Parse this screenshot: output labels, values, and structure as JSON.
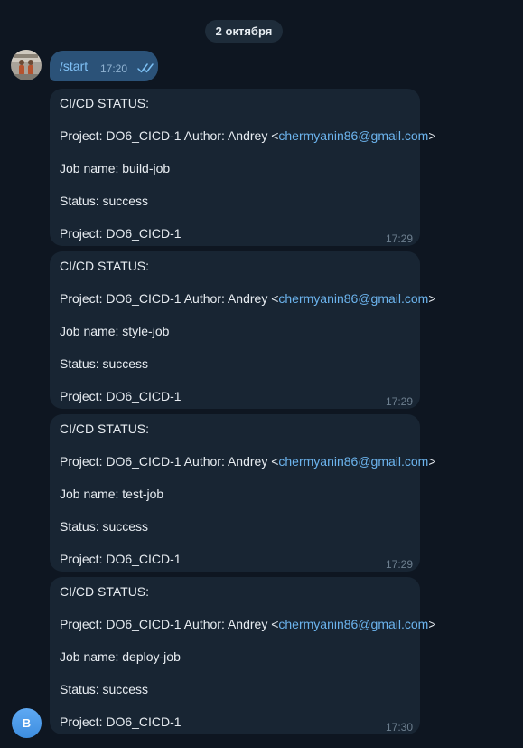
{
  "chat": {
    "date_label": "2 октября",
    "outgoing": {
      "text": "/start",
      "time": "17:20",
      "status_icon": "double-check-read-icon"
    },
    "bot_avatar_letter": "B",
    "messages": [
      {
        "title": "CI/CD STATUS:",
        "project_line_prefix": "Project: DO6_CICD-1 Author: Andrey <",
        "email": "chermyanin86@gmail.com",
        "project_line_suffix": ">",
        "job_line": "Job name: build-job",
        "status_line": "Status: success",
        "project_line": "Project: DO6_CICD-1",
        "time": "17:29"
      },
      {
        "title": "CI/CD STATUS:",
        "project_line_prefix": "Project: DO6_CICD-1 Author: Andrey <",
        "email": "chermyanin86@gmail.com",
        "project_line_suffix": ">",
        "job_line": "Job name: style-job",
        "status_line": "Status: success",
        "project_line": "Project: DO6_CICD-1",
        "time": "17:29"
      },
      {
        "title": "CI/CD STATUS:",
        "project_line_prefix": "Project: DO6_CICD-1 Author: Andrey <",
        "email": "chermyanin86@gmail.com",
        "project_line_suffix": ">",
        "job_line": "Job name: test-job",
        "status_line": "Status: success",
        "project_line": "Project: DO6_CICD-1",
        "time": "17:29"
      },
      {
        "title": "CI/CD STATUS:",
        "project_line_prefix": "Project: DO6_CICD-1 Author: Andrey <",
        "email": "chermyanin86@gmail.com",
        "project_line_suffix": ">",
        "job_line": "Job name: deploy-job",
        "status_line": "Status: success",
        "project_line": "Project: DO6_CICD-1",
        "time": "17:30"
      }
    ]
  },
  "colors": {
    "background": "#0e1621",
    "incoming_bubble": "#182533",
    "outgoing_bubble": "#2b5278",
    "link": "#6cb4ee",
    "avatar_accent": "#4b9be8"
  }
}
